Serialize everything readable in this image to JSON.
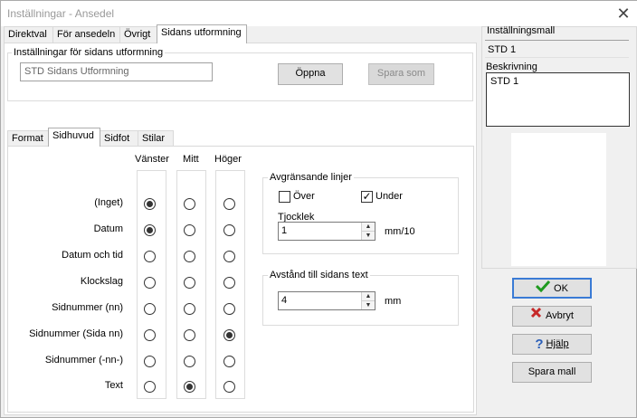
{
  "window": {
    "title": "Inställningar - Ansedel",
    "close_glyph": "✕"
  },
  "top_tabs": [
    {
      "label": "Direktval"
    },
    {
      "label": "För ansedeln"
    },
    {
      "label": "Övrigt"
    },
    {
      "label": "Sidans utformning"
    }
  ],
  "settings_group": {
    "label": "Inställningar för sidans utformning",
    "field_value": "STD Sidans Utformning",
    "open_button": "Öppna",
    "save_as_button": "Spara som"
  },
  "sub_tabs": [
    {
      "label": "Format"
    },
    {
      "label": "Sidhuvud"
    },
    {
      "label": "Sidfot"
    },
    {
      "label": "Stilar"
    }
  ],
  "header_grid": {
    "columns": [
      "Vänster",
      "Mitt",
      "Höger"
    ],
    "rows": [
      {
        "label": "(Inget)",
        "selected": 0
      },
      {
        "label": "Datum",
        "selected": 0
      },
      {
        "label": "Datum och tid",
        "selected": -1
      },
      {
        "label": "Klockslag",
        "selected": -1
      },
      {
        "label": "Sidnummer (nn)",
        "selected": -1
      },
      {
        "label": "Sidnummer (Sida nn)",
        "selected": 2
      },
      {
        "label": "Sidnummer (-nn-)",
        "selected": -1
      },
      {
        "label": "Text",
        "selected": 1
      }
    ]
  },
  "dividing_lines": {
    "label": "Avgränsande linjer",
    "over_label": "Över",
    "over_checked": false,
    "under_label": "Under",
    "under_checked": true,
    "thickness_label": "Tjocklek",
    "thickness_value": "1",
    "thickness_unit": "mm/10",
    "checkmark_glyph": "✓"
  },
  "distance": {
    "label": "Avstånd till sidans text",
    "value": "4",
    "unit": "mm"
  },
  "template": {
    "label": "Inställningsmall",
    "value": "STD 1",
    "description_label": "Beskrivning",
    "description_value": "STD 1"
  },
  "buttons": {
    "ok": "OK",
    "cancel": "Avbryt",
    "help": "Hjälp",
    "save_template": "Spara mall"
  },
  "icons": {
    "ok": "check-icon",
    "cancel": "x-icon",
    "help": "question-icon"
  },
  "colors": {
    "ok_check": "#1f9a1f",
    "cancel_x": "#c62828",
    "help_q": "#2b5fb8",
    "focus": "#3a7bd5"
  }
}
